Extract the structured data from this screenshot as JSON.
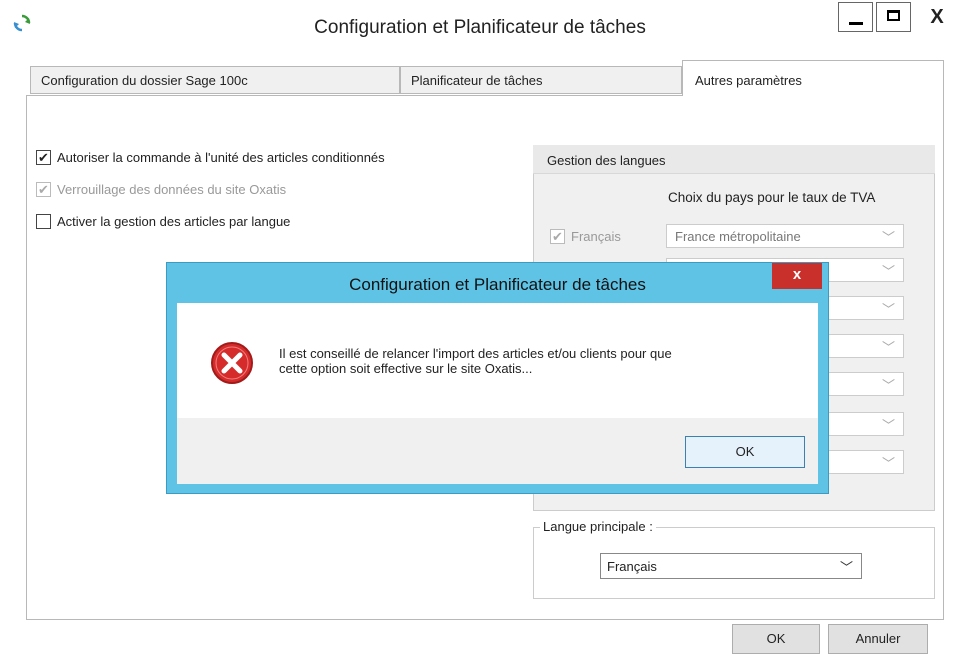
{
  "window": {
    "title": "Configuration et Planificateur de tâches",
    "close_glyph": "X"
  },
  "tabs": [
    {
      "label": "Configuration du dossier Sage 100c",
      "active": false
    },
    {
      "label": "Planificateur de tâches",
      "active": false
    },
    {
      "label": "Autres paramètres",
      "active": true
    }
  ],
  "options": [
    {
      "label": "Autoriser la commande à l'unité des articles conditionnés",
      "checked": true,
      "enabled": true
    },
    {
      "label": "Verrouillage des données du site Oxatis",
      "checked": true,
      "enabled": false
    },
    {
      "label": "Activer la gestion des articles par langue",
      "checked": false,
      "enabled": true
    }
  ],
  "langues": {
    "title": "Gestion des langues",
    "column_header": "Choix du pays pour le taux de TVA",
    "rows": [
      {
        "language": "Français",
        "checked": true,
        "country": "France métropolitaine"
      }
    ]
  },
  "principal": {
    "label": "Langue principale :",
    "selected": "Français"
  },
  "buttons": {
    "ok": "OK",
    "cancel": "Annuler"
  },
  "dialog": {
    "title": "Configuration et Planificateur de tâches",
    "close_glyph": "x",
    "message_line1": "Il est conseillé de relancer l'import des articles et/ou clients pour que",
    "message_line2": "cette option soit effective sur le site Oxatis...",
    "ok": "OK"
  },
  "colors": {
    "dialog_frame": "#5fc3e6",
    "dialog_close": "#c9302c",
    "error_icon": "#d62b2b"
  }
}
